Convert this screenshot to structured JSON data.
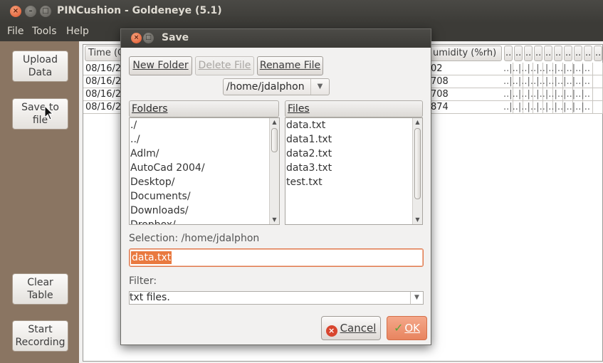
{
  "window": {
    "title": "PINCushion - Goldeneye (5.1)"
  },
  "menu": {
    "items": [
      "File",
      "Tools",
      "Help"
    ]
  },
  "left_panel": {
    "upload_label": "Upload\nData",
    "save_label": "Save to\nfile",
    "clear_label": "Clear\nTable",
    "record_label": "Start\nRecording"
  },
  "table": {
    "col_time": "Time (C",
    "col_humidity": "umidity (%rh)",
    "extra_col": "..",
    "rows": [
      {
        "time": "08/16/2",
        "humidity": "02"
      },
      {
        "time": "08/16/2",
        "humidity": "708"
      },
      {
        "time": "08/16/2",
        "humidity": "708"
      },
      {
        "time": "08/16/2",
        "humidity": "874"
      }
    ],
    "dots": "..|..|..|..|..|..|..|..|..|.."
  },
  "dialog": {
    "title": "Save",
    "new_folder": "New Folder",
    "delete_file": "Delete File",
    "rename_file": "Rename File",
    "path": "/home/jdalphon",
    "folders_header": "Folders",
    "files_header": "Files",
    "folders": [
      "./",
      "../",
      "Adlm/",
      "AutoCad 2004/",
      "Desktop/",
      "Documents/",
      "Downloads/",
      "Dropbox/"
    ],
    "files": [
      "data.txt",
      "data1.txt",
      "data2.txt",
      "data3.txt",
      "test.txt"
    ],
    "selection_label": "Selection: /home/jdalphon",
    "filename": "data.txt",
    "filter_label": "Filter:",
    "filter_value": "txt files.",
    "cancel": "Cancel",
    "ok": "OK"
  },
  "colors": {
    "accent": "#e9793f",
    "left_panel": "#8a7562",
    "titlebar": "#3c3b37"
  }
}
